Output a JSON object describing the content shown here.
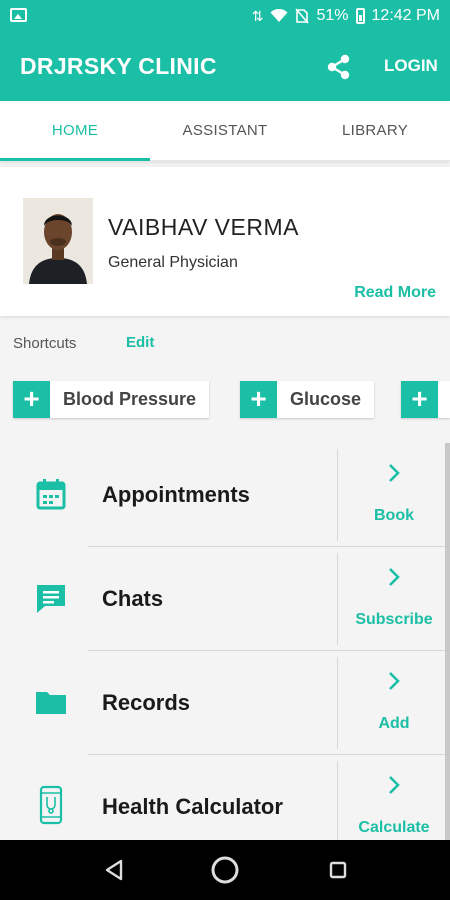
{
  "status_bar": {
    "battery": "51%",
    "time": "12:42 PM"
  },
  "app_bar": {
    "title": "DRJRSKY CLINIC",
    "login_label": "LOGIN"
  },
  "tabs": [
    {
      "label": "HOME",
      "active": true
    },
    {
      "label": "ASSISTANT",
      "active": false
    },
    {
      "label": "LIBRARY",
      "active": false
    }
  ],
  "profile": {
    "name": "VAIBHAV VERMA",
    "role": "General Physician",
    "read_more": "Read More"
  },
  "shortcuts": {
    "label": "Shortcuts",
    "edit_label": "Edit",
    "chips": [
      "Blood Pressure",
      "Glucose"
    ]
  },
  "menu": [
    {
      "title": "Appointments",
      "action": "Book",
      "icon": "calendar-icon"
    },
    {
      "title": "Chats",
      "action": "Subscribe",
      "icon": "chat-icon"
    },
    {
      "title": "Records",
      "action": "Add",
      "icon": "folder-icon"
    },
    {
      "title": "Health Calculator",
      "action": "Calculate",
      "icon": "phone-calculator-icon"
    }
  ],
  "colors": {
    "accent": "#1bbfa5",
    "background": "#f4f4f4",
    "nav_bar": "#000000"
  }
}
